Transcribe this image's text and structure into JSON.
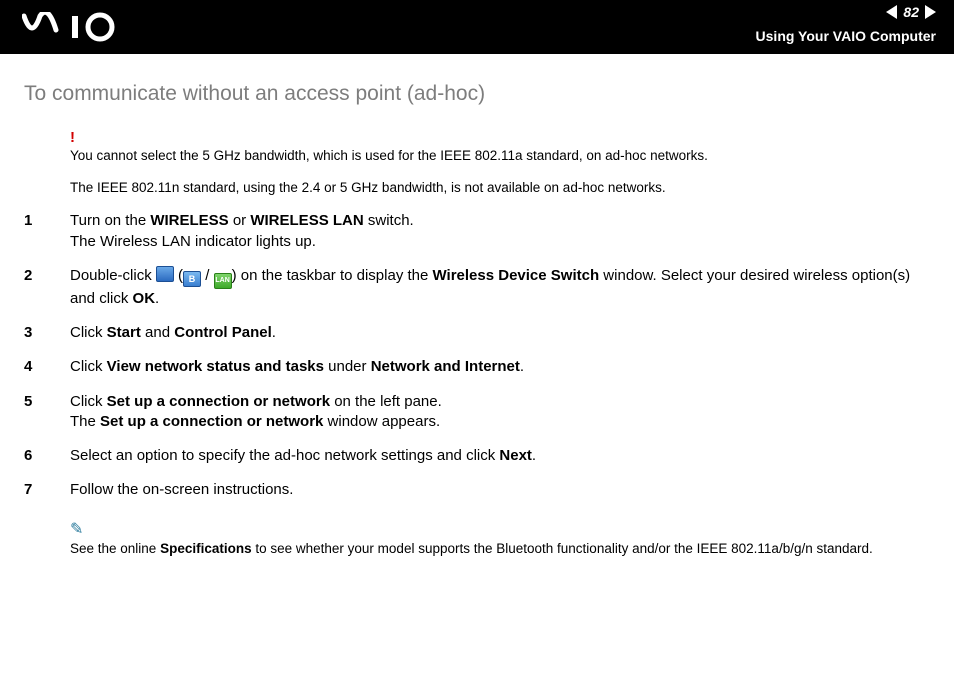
{
  "header": {
    "page_number": "82",
    "section": "Using Your VAIO Computer"
  },
  "heading": "To communicate without an access point (ad-hoc)",
  "alert": {
    "mark": "!",
    "line1": "You cannot select the 5 GHz bandwidth, which is used for the IEEE 802.11a standard, on ad-hoc networks.",
    "line2": "The IEEE 802.11n standard, using the 2.4 or 5 GHz bandwidth, is not available on ad-hoc networks."
  },
  "steps": {
    "s1a": "Turn on the ",
    "s1b": "WIRELESS",
    "s1c": " or ",
    "s1d": "WIRELESS LAN",
    "s1e": " switch.",
    "s1f": "The Wireless LAN indicator lights up.",
    "s2a": "Double-click ",
    "s2b": " (",
    "s2c": " / ",
    "s2d": ") on the taskbar to display the ",
    "s2e": "Wireless Device Switch",
    "s2f": " window. Select your desired wireless option(s) and click ",
    "s2g": "OK",
    "s2h": ".",
    "s3a": "Click ",
    "s3b": "Start",
    "s3c": " and ",
    "s3d": "Control Panel",
    "s3e": ".",
    "s4a": "Click ",
    "s4b": "View network status and tasks",
    "s4c": " under ",
    "s4d": "Network and Internet",
    "s4e": ".",
    "s5a": "Click ",
    "s5b": "Set up a connection or network",
    "s5c": " on the left pane.",
    "s5d": "The ",
    "s5e": "Set up a connection or network",
    "s5f": " window appears.",
    "s6a": "Select an option to specify the ad-hoc network settings and click ",
    "s6b": "Next",
    "s6c": ".",
    "s7": "Follow the on-screen instructions."
  },
  "footnote": {
    "pre": "See the online ",
    "bold": "Specifications",
    "post": " to see whether your model supports the Bluetooth functionality and/or the IEEE 802.11a/b/g/n standard."
  },
  "icons": {
    "b_label": "B",
    "lan_label": "LAN"
  }
}
